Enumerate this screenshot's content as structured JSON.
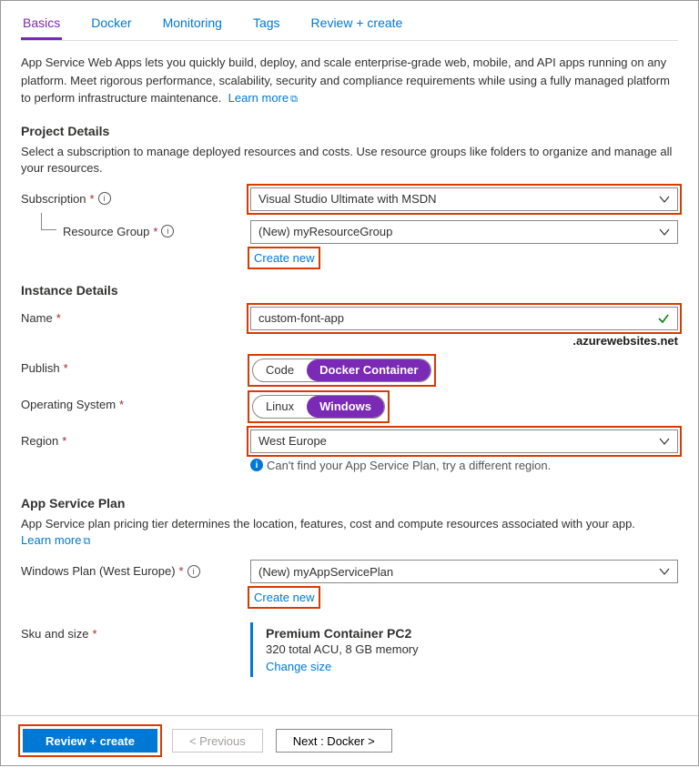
{
  "tabs": {
    "basics": "Basics",
    "docker": "Docker",
    "monitoring": "Monitoring",
    "tags": "Tags",
    "review": "Review + create"
  },
  "intro": {
    "text": "App Service Web Apps lets you quickly build, deploy, and scale enterprise-grade web, mobile, and API apps running on any platform. Meet rigorous performance, scalability, security and compliance requirements while using a fully managed platform to perform infrastructure maintenance.",
    "learn_more": "Learn more"
  },
  "project": {
    "heading": "Project Details",
    "desc": "Select a subscription to manage deployed resources and costs. Use resource groups like folders to organize and manage all your resources.",
    "subscription_label": "Subscription",
    "subscription_value": "Visual Studio Ultimate with MSDN",
    "rg_label": "Resource Group",
    "rg_value": "(New) myResourceGroup",
    "create_new": "Create new"
  },
  "instance": {
    "heading": "Instance Details",
    "name_label": "Name",
    "name_value": "custom-font-app",
    "name_suffix": ".azurewebsites.net",
    "publish_label": "Publish",
    "publish_code": "Code",
    "publish_docker": "Docker Container",
    "os_label": "Operating System",
    "os_linux": "Linux",
    "os_windows": "Windows",
    "region_label": "Region",
    "region_value": "West Europe",
    "region_hint": "Can't find your App Service Plan, try a different region."
  },
  "plan": {
    "heading": "App Service Plan",
    "desc": "App Service plan pricing tier determines the location, features, cost and compute resources associated with your app.",
    "learn_more": "Learn more",
    "winplan_label": "Windows Plan (West Europe)",
    "winplan_value": "(New) myAppServicePlan",
    "create_new": "Create new",
    "sku_label": "Sku and size",
    "sku_title": "Premium Container PC2",
    "sku_sub": "320 total ACU, 8 GB memory",
    "sku_change": "Change size"
  },
  "footer": {
    "review": "Review + create",
    "prev": "< Previous",
    "next": "Next : Docker >"
  }
}
